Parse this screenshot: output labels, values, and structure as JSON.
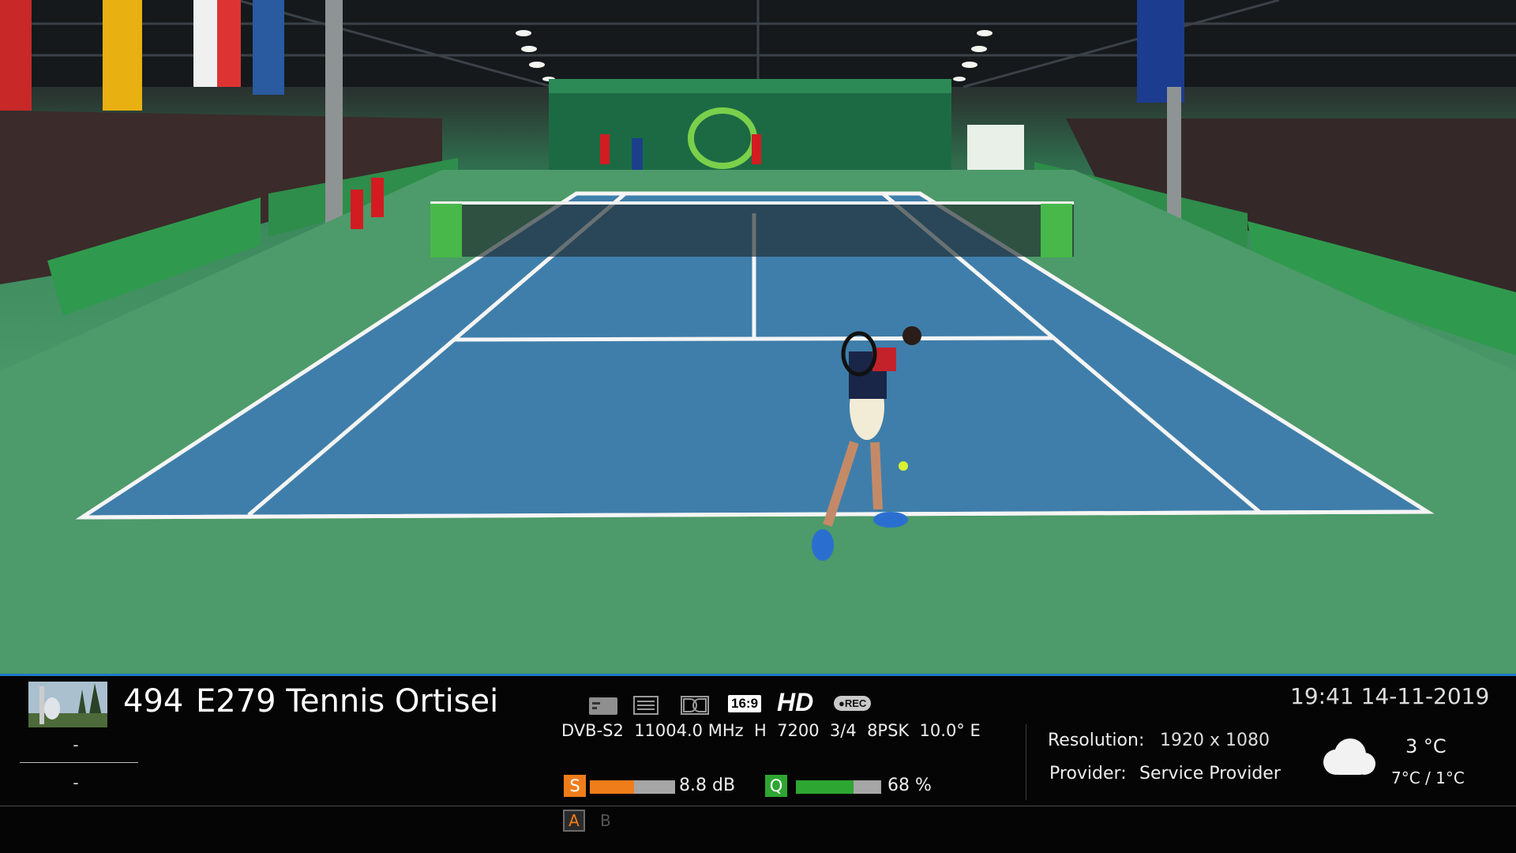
{
  "channel": {
    "number": "494",
    "name": "E279 Tennis Ortisei",
    "picon": "channel-picon-image"
  },
  "event": {
    "now": "-",
    "next": "-"
  },
  "status_icons": [
    "subtitle-icon",
    "teletext-icon",
    "dolby-icon",
    "aspect-16-9-icon",
    "hd-icon",
    "rec-icon"
  ],
  "labels": {
    "aspect": "16:9",
    "hd": "HD",
    "rec": "●REC"
  },
  "tuner": {
    "line": "DVB-S2  11004.0 MHz  H  7200  3/4  8PSK  10.0° E"
  },
  "signal": {
    "snr_label": "S",
    "snr_value": "8.8 dB",
    "snr_fraction": 0.52,
    "quality_label": "Q",
    "quality_value": "68 %",
    "quality_fraction": 0.68,
    "snr_color": "#ef7d1a",
    "quality_color": "#2ea632"
  },
  "info": {
    "resolution_label": "Resolution:",
    "resolution_value": "1920 x 1080",
    "provider_label": "Provider:",
    "provider_value": "Service Provider"
  },
  "clock": "19:41 14-11-2019",
  "weather": {
    "icon": "cloud-icon",
    "current": "3 °C",
    "range": "7°C / 1°C"
  },
  "audio": {
    "track_a": "A",
    "track_b": "B"
  },
  "colors": {
    "accent_line": "#1d78c8",
    "background": "#050505"
  }
}
